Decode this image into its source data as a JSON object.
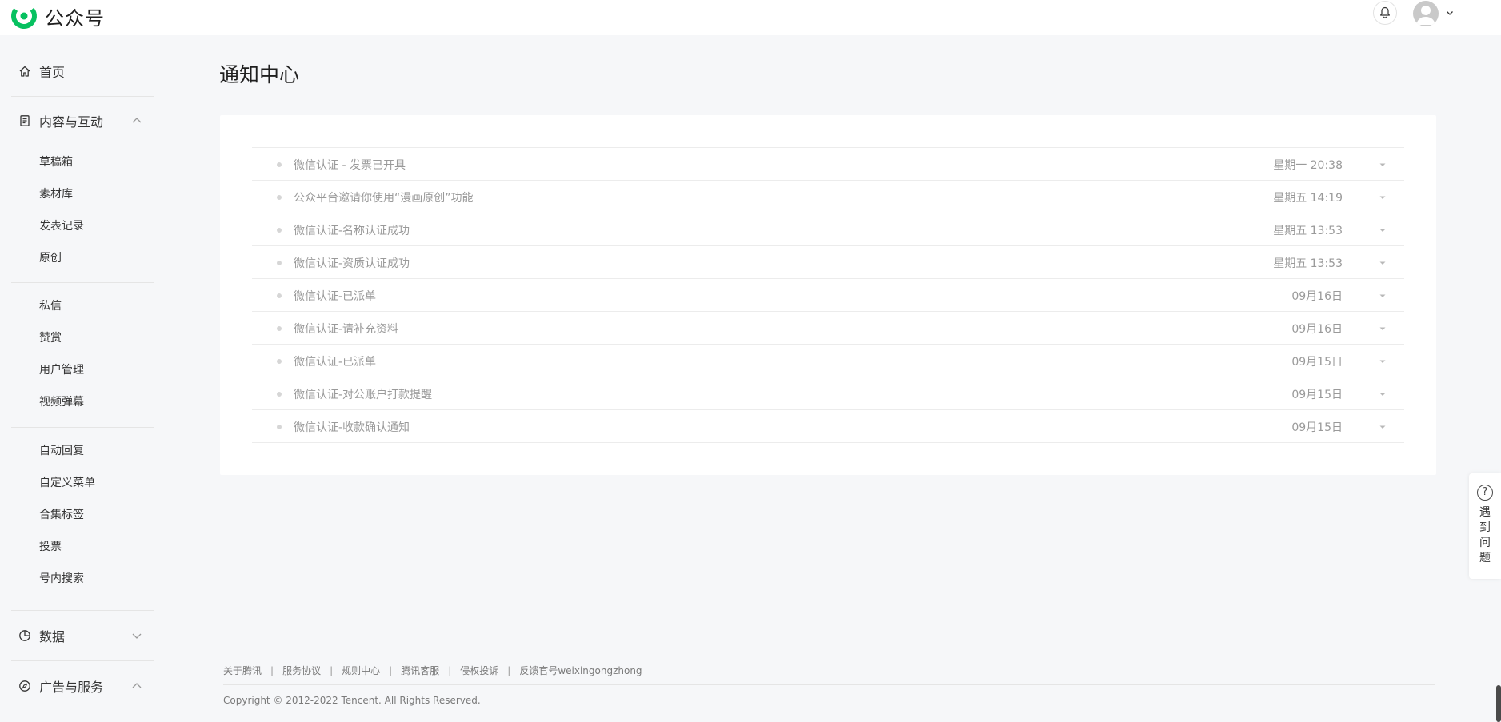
{
  "header": {
    "logo_text": "公众号",
    "brand_color": "#07c160"
  },
  "sidebar": {
    "home": {
      "label": "首页",
      "icon": "home-icon"
    },
    "content": {
      "label": "内容与互动",
      "icon": "document-icon",
      "groups": [
        [
          "草稿箱",
          "素材库",
          "发表记录",
          "原创"
        ],
        [
          "私信",
          "赞赏",
          "用户管理",
          "视频弹幕"
        ],
        [
          "自动回复",
          "自定义菜单",
          "合集标签",
          "投票",
          "号内搜索"
        ]
      ]
    },
    "data": {
      "label": "数据",
      "icon": "pie-chart-icon"
    },
    "ads": {
      "label": "广告与服务",
      "icon": "compass-icon"
    }
  },
  "main": {
    "title": "通知中心",
    "notices": [
      {
        "title": "微信认证 - 发票已开具",
        "time": "星期一 20:38"
      },
      {
        "title": "公众平台邀请你使用“漫画原创”功能",
        "time": "星期五 14:19"
      },
      {
        "title": "微信认证-名称认证成功",
        "time": "星期五 13:53"
      },
      {
        "title": "微信认证-资质认证成功",
        "time": "星期五 13:53"
      },
      {
        "title": "微信认证-已派单",
        "time": "09月16日"
      },
      {
        "title": "微信认证-请补充资料",
        "time": "09月16日"
      },
      {
        "title": "微信认证-已派单",
        "time": "09月15日"
      },
      {
        "title": "微信认证-对公账户打款提醒",
        "time": "09月15日"
      },
      {
        "title": "微信认证-收款确认通知",
        "time": "09月15日"
      }
    ]
  },
  "footer": {
    "links": [
      "关于腾讯",
      "服务协议",
      "规则中心",
      "腾讯客服",
      "侵权投诉",
      "反馈官号weixingongzhong"
    ],
    "separator": "|",
    "copyright": "Copyright © 2012-2022 Tencent. All Rights Reserved."
  },
  "help": {
    "text": "遇到问题",
    "icon": "question-icon"
  }
}
